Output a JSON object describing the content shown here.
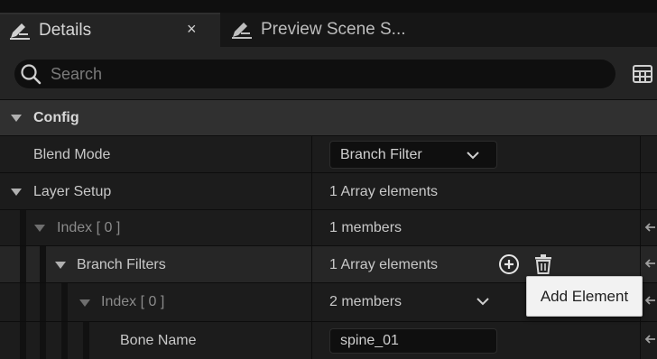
{
  "tabs": [
    {
      "label": "Details",
      "icon": "pencil-icon",
      "active": true
    },
    {
      "label": "Preview Scene S...",
      "icon": "pencil-icon",
      "active": false
    }
  ],
  "tab_close_glyph": "×",
  "search": {
    "placeholder": "Search",
    "value": ""
  },
  "category": {
    "label": "Config"
  },
  "rows": {
    "blend_mode": {
      "name": "Blend Mode",
      "value": "Branch Filter"
    },
    "layer_setup": {
      "name": "Layer Setup",
      "value": "1 Array elements"
    },
    "index0": {
      "name": "Index",
      "bracket": "[ 0 ]",
      "value": "1 members"
    },
    "branch_filters": {
      "name": "Branch Filters",
      "value": "1 Array elements"
    },
    "index0_inner": {
      "name": "Index",
      "bracket": "[ 0 ]",
      "value": "2 members"
    },
    "bone_name": {
      "name": "Bone Name",
      "value": "spine_01"
    }
  },
  "tooltip": {
    "text": "Add Element"
  },
  "colors": {
    "background": "#151515",
    "panel": "#242424",
    "category": "#303030",
    "tooltip_bg": "#f2f2f2"
  }
}
